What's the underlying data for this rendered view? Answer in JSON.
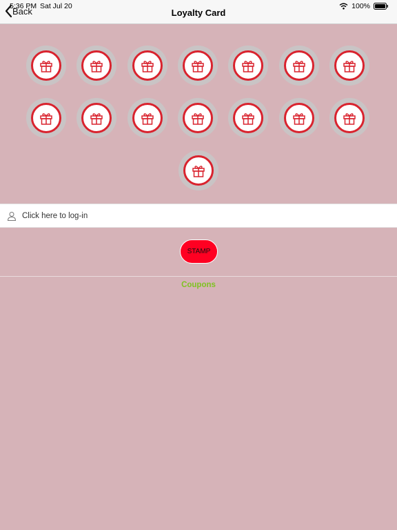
{
  "status": {
    "time": "5:36 PM",
    "date": "Sat Jul 20",
    "battery": "100%"
  },
  "nav": {
    "back_label": "Back",
    "title": "Loyalty Card"
  },
  "stamps": {
    "count": 15,
    "icon": "gift-icon",
    "colors": {
      "ring": "#d9232e",
      "halo": "#c9c4c5"
    }
  },
  "login": {
    "label": "Click here to log-in"
  },
  "stamp_button": {
    "label": "STAMP"
  },
  "coupons": {
    "label": "Coupons"
  },
  "colors": {
    "background": "#d6b3b8",
    "accent_red": "#ff0022",
    "coupons_green": "#7ec322"
  }
}
